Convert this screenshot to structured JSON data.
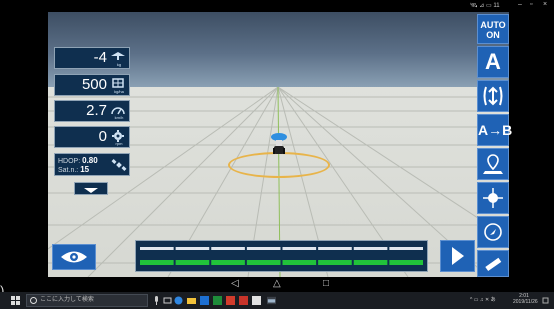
{
  "status_bar": {
    "text": "🛰 ⊿ ▭ 11",
    "window_controls": [
      "–",
      "▫",
      "×"
    ]
  },
  "left_panel": {
    "rows": [
      {
        "value": "-4",
        "icon": "sprayer-icon",
        "unit": "kg"
      },
      {
        "value": "500",
        "icon": "area-rate-icon",
        "unit": "kg/ha"
      },
      {
        "value": "2.7",
        "icon": "speedometer-icon",
        "unit": "km/h"
      },
      {
        "value": "0",
        "icon": "gear-icon",
        "unit": "rpm"
      }
    ],
    "hdop_label": "HDOP:",
    "hdop_value": "0.80",
    "sat_label": "Sat.n.:",
    "sat_value": "15",
    "gps_icon": "satellite-icon",
    "collapse_icon": "chevron-down-icon"
  },
  "right_toolbar": {
    "auto": [
      "AUTO",
      "ON"
    ],
    "a_label": "A",
    "ab_label": "A",
    "ab_suffix": "B",
    "icons": [
      "auto-steer-icon",
      "a-letter-icon",
      "field-boundary-icon",
      "ab-line-icon",
      "map-pin-icon",
      "light-bar-icon",
      "compass-icon",
      "ruler-icon"
    ]
  },
  "bottom": {
    "view_icon": "eye-icon",
    "sections_count": 8,
    "next_icon": "chevron-right-icon"
  },
  "android_nav": [
    "◁",
    "△",
    "□"
  ],
  "taskbar": {
    "search_placeholder": "ここに入力して検索",
    "tray_text": "^ ▭ ♫ ✕ あ",
    "clock_time": "2:01",
    "clock_date": "2019/11/26"
  },
  "colors": {
    "panel": "#0f2f4f",
    "button": "#1f62b5",
    "section_active": "#21c23a",
    "ring": "#e8b44a"
  }
}
